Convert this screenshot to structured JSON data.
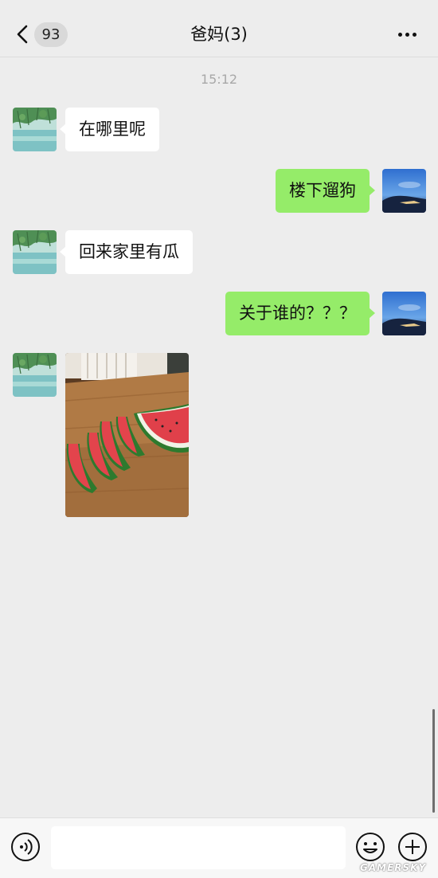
{
  "header": {
    "unread_count": "93",
    "title": "爸妈(3)"
  },
  "timestamp": "15:12",
  "messages": [
    {
      "sender": "other",
      "text": "在哪里呢"
    },
    {
      "sender": "me",
      "text": "楼下遛狗"
    },
    {
      "sender": "other",
      "text": "回来家里有瓜"
    },
    {
      "sender": "me",
      "text": "关于谁的？？？"
    },
    {
      "sender": "other",
      "type": "image",
      "content": "watermelon-slices-photo"
    }
  ],
  "input": {
    "value": "",
    "placeholder": ""
  },
  "watermark": "GAMERSKY",
  "colors": {
    "background": "#ededed",
    "outgoing_bubble": "#95ec69",
    "incoming_bubble": "#ffffff"
  },
  "icons": [
    "back-arrow-icon",
    "more-icon",
    "voice-icon",
    "emoji-icon",
    "plus-icon"
  ]
}
